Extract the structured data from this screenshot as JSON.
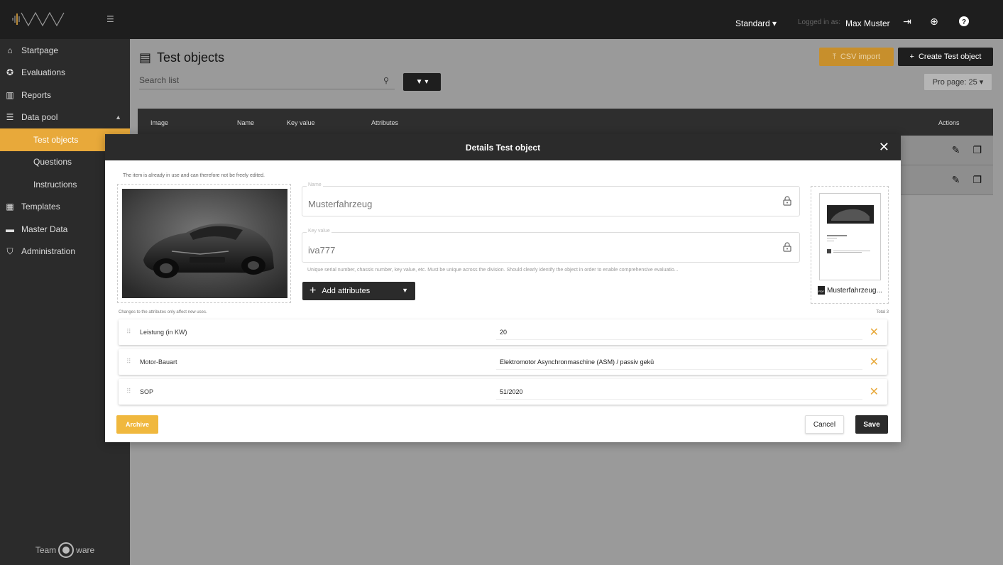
{
  "app": {
    "brand": "Team ware",
    "logo_icon": "waveform-logo-icon"
  },
  "sidebar": {
    "items": [
      {
        "label": "Startpage",
        "icon": "home-icon"
      },
      {
        "label": "Evaluations",
        "icon": "star-circle-icon"
      },
      {
        "label": "Reports",
        "icon": "chart-icon"
      },
      {
        "label": "Data pool",
        "icon": "list-icon"
      },
      {
        "label": "Test objects",
        "active": true
      },
      {
        "label": "Questions"
      },
      {
        "label": "Instructions"
      },
      {
        "label": "Templates",
        "icon": "table-icon"
      },
      {
        "label": "Master Data",
        "icon": "keyboard-icon"
      },
      {
        "label": "Administration",
        "icon": "shield-check-icon"
      }
    ]
  },
  "topbar": {
    "view": "Standard",
    "logged_in_label": "Logged in as:",
    "user": "Max Muster"
  },
  "page": {
    "title": "Test objects",
    "search_placeholder": "Search list",
    "csv_import": "CSV import",
    "create": "Create Test object",
    "per_page": "Pro page: 25",
    "columns": [
      "Image",
      "Name",
      "Key value",
      "Attributes",
      "Actions"
    ]
  },
  "modal": {
    "title": "Details Test object",
    "note": "The item is already in use and can therefore not be freely edited.",
    "name_label": "Name",
    "name_value": "Musterfahrzeug",
    "key_label": "Key value",
    "key_value": "iva777",
    "key_hint": "Unique serial number, chassis number, key value, etc. Must be unique across the division. Should clearly identify the object in order to enable comprehensive evaluatio...",
    "add_attributes": "Add attributes",
    "pdf_name": "Musterfahrzeug...",
    "changes_note": "Changes to the attributes only affect new uses.",
    "total": "Total 3",
    "attributes": [
      {
        "name": "Leistung (in KW)",
        "value": "20"
      },
      {
        "name": "Motor-Bauart",
        "value": "Elektromotor Asynchronmaschine (ASM) / passiv gekü"
      },
      {
        "name": "SOP",
        "value": "51/2020"
      }
    ],
    "archive": "Archive",
    "cancel": "Cancel",
    "save": "Save"
  },
  "colors": {
    "accent": "#e8a93a",
    "dark": "#2b2b2b",
    "topbar": "#1e1e1e"
  }
}
